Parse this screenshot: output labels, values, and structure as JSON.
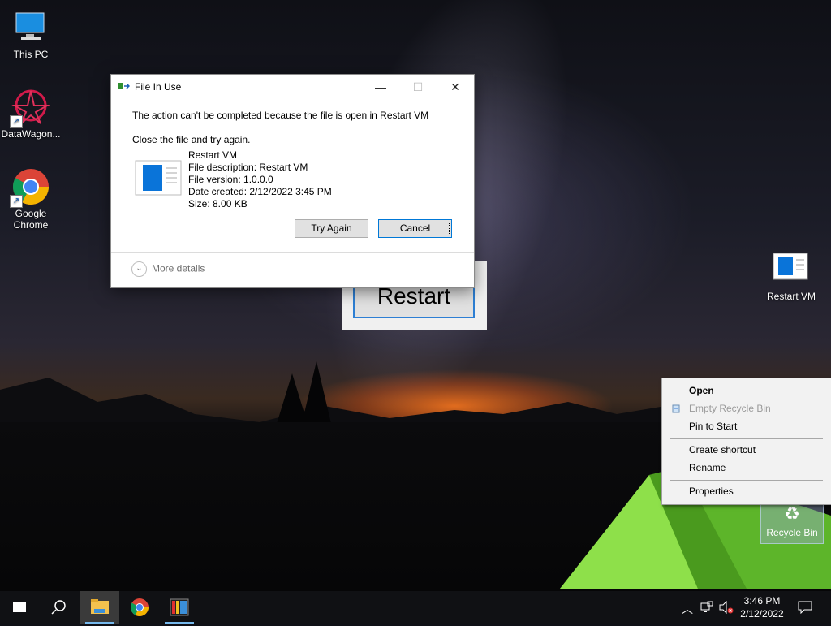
{
  "desktop": {
    "icons": [
      {
        "label": "This PC"
      },
      {
        "label": "DataWagon..."
      },
      {
        "label": "Google Chrome"
      },
      {
        "label": "Restart VM"
      },
      {
        "label": "Recycle Bin"
      }
    ]
  },
  "restart_app": {
    "button_label": "Restart"
  },
  "dialog": {
    "title": "File In Use",
    "message": "The action can't be completed because the file is open in Restart VM",
    "instruction": "Close the file and try again.",
    "file_name": "Restart VM",
    "file_description": "File description: Restart VM",
    "file_version": "File version: 1.0.0.0",
    "date_created": "Date created: 2/12/2022 3:45 PM",
    "size": "Size: 8.00 KB",
    "try_again": "Try Again",
    "cancel": "Cancel",
    "more_details": "More details",
    "minimize_icon": "minimize-icon",
    "maximize_icon": "maximize-icon",
    "close_icon": "close-icon"
  },
  "context_menu": {
    "items": [
      {
        "label": "Open",
        "bold": true,
        "enabled": true
      },
      {
        "label": "Empty Recycle Bin",
        "enabled": false
      },
      {
        "label": "Pin to Start",
        "enabled": true
      },
      {
        "label": "Create shortcut",
        "enabled": true
      },
      {
        "label": "Rename",
        "enabled": true
      },
      {
        "label": "Properties",
        "enabled": true
      }
    ]
  },
  "taskbar": {
    "time": "3:46 PM",
    "date": "2/12/2022",
    "icons": [
      "start-icon",
      "search-icon",
      "file-explorer-icon",
      "chrome-icon",
      "restart-vm-app-icon"
    ],
    "tray_icons": [
      "chevron-up-icon",
      "network-icon",
      "volume-muted-icon",
      "notifications-icon"
    ]
  },
  "colors": {
    "accent": "#0078d7",
    "taskbar": "#101114"
  }
}
